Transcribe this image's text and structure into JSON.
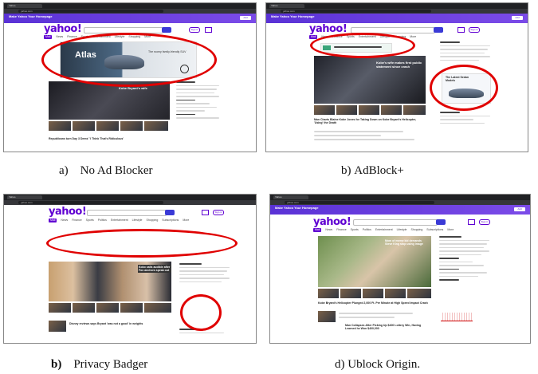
{
  "captions": {
    "a_label": "a)",
    "a_text": "No Ad Blocker",
    "b_label": "b)",
    "b_text": "AdBlock+",
    "c_label": "b)",
    "c_text": "Privacy Badger",
    "d_label": "d)",
    "d_text": "Ublock Origin."
  },
  "browser": {
    "tab_title": "Yahoo",
    "url": "yahoo.com"
  },
  "promo": {
    "title": "Make Yahoo Your Homepage",
    "button": "Add"
  },
  "yahoo": {
    "logo": "yahoo!",
    "sign_in": "Sign in",
    "nav": [
      "Mail",
      "News",
      "Finance",
      "Sports",
      "Politics",
      "Entertainment",
      "Lifestyle",
      "Shopping",
      "Subscriptions",
      "More"
    ]
  },
  "panel_a": {
    "ad_brand": "Atlas",
    "ad_tagline": "The roomy family-friendly SUV",
    "story_headline": "Kobe Bryant's wife",
    "news_headline": "Republicans turn Day 3 Dems' 'I Think That's Ridiculous'"
  },
  "panel_b": {
    "story_headline": "Kobe's wife makes first public statement since crash",
    "side_ad": "The Latest Sedan Models",
    "news_headline": "Man Charts Blaine Kobe Jones for Taking Down on Kobe Bryant's Helicopter, 'Using' the Death"
  },
  "panel_c": {
    "story_headline": "Koko calls audible after Fox anchors speak out",
    "news_headline": "Disney reviews says Bryant 'was not a good' in weights"
  },
  "panel_d": {
    "story_headline": "Mom of meme kid demands Steve King stop using image",
    "news_headline": "Kobe Bryant's Helicopter Plunged 2,000 Ft. Per Minute at High Speed Impact Crash",
    "news_headline_2": "Man Collapses After Picking Up $400 Lottery Win, Having Learned he Won $400,000"
  },
  "colors": {
    "yahoo_purple": "#6001d2",
    "annotation_red": "#e00000",
    "chrome_dark": "#202124"
  }
}
